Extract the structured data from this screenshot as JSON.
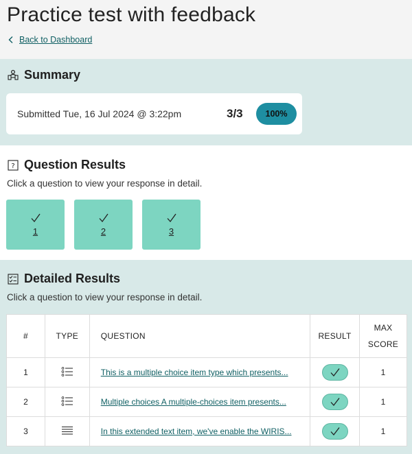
{
  "header": {
    "title": "Practice test with feedback",
    "back_link": "Back to Dashboard"
  },
  "summary": {
    "heading": "Summary",
    "submitted": "Submitted Tue, 16 Jul 2024 @ 3:22pm",
    "score": "3/3",
    "percent": "100%"
  },
  "question_results": {
    "heading": "Question Results",
    "hint": "Click a question to view your response in detail.",
    "tiles": [
      {
        "number": "1",
        "status": "correct"
      },
      {
        "number": "2",
        "status": "correct"
      },
      {
        "number": "3",
        "status": "correct"
      }
    ]
  },
  "detailed_results": {
    "heading": "Detailed Results",
    "hint": "Click a question to view your response in detail.",
    "columns": {
      "number": "#",
      "type": "TYPE",
      "question": "QUESTION",
      "result": "RESULT",
      "max_line1": "MAX",
      "max_line2": "SCORE"
    },
    "rows": [
      {
        "number": "1",
        "type_icon": "list-icon",
        "question": "This is a multiple choice item type which presents...",
        "result": "correct",
        "max_score": "1"
      },
      {
        "number": "2",
        "type_icon": "list-icon",
        "question": "Multiple choices A multiple-choices item presents...",
        "result": "correct",
        "max_score": "1"
      },
      {
        "number": "3",
        "type_icon": "text-lines-icon",
        "question": "In this extended text item, we've enable the WIRIS...",
        "result": "correct",
        "max_score": "1"
      }
    ]
  },
  "colors": {
    "accent_teal": "#7dd5c1",
    "badge_blue": "#1e8ea1",
    "section_bg": "#d8e9e8",
    "link": "#0f5f63"
  }
}
